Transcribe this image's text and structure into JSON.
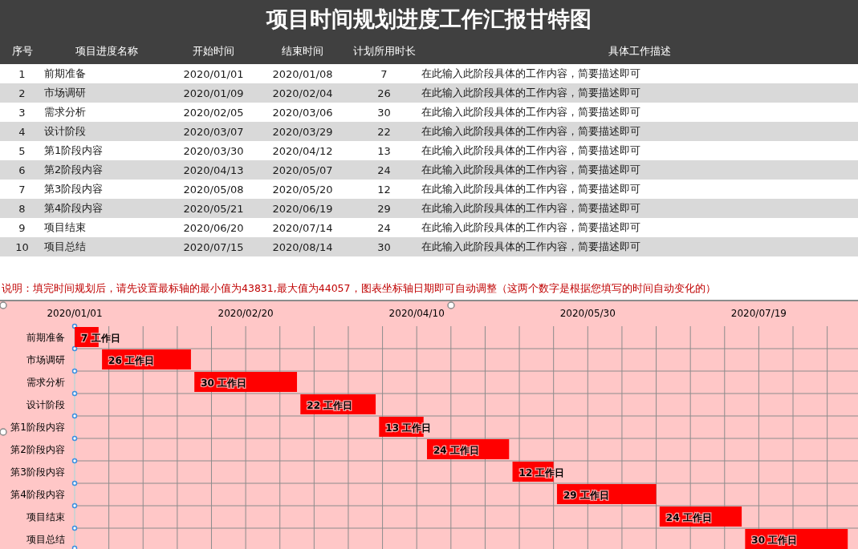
{
  "title": "项目时间规划进度工作汇报甘特图",
  "table": {
    "columns": [
      "序号",
      "项目进度名称",
      "开始时间",
      "结束时间",
      "计划所用时长",
      "具体工作描述"
    ],
    "rows": [
      [
        "1",
        "前期准备",
        "2020/01/01",
        "2020/01/08",
        "7",
        "在此输入此阶段具体的工作内容，简要描述即可"
      ],
      [
        "2",
        "市场调研",
        "2020/01/09",
        "2020/02/04",
        "26",
        "在此输入此阶段具体的工作内容，简要描述即可"
      ],
      [
        "3",
        "需求分析",
        "2020/02/05",
        "2020/03/06",
        "30",
        "在此输入此阶段具体的工作内容，简要描述即可"
      ],
      [
        "4",
        "设计阶段",
        "2020/03/07",
        "2020/03/29",
        "22",
        "在此输入此阶段具体的工作内容，简要描述即可"
      ],
      [
        "5",
        "第1阶段内容",
        "2020/03/30",
        "2020/04/12",
        "13",
        "在此输入此阶段具体的工作内容，简要描述即可"
      ],
      [
        "6",
        "第2阶段内容",
        "2020/04/13",
        "2020/05/07",
        "24",
        "在此输入此阶段具体的工作内容，简要描述即可"
      ],
      [
        "7",
        "第3阶段内容",
        "2020/05/08",
        "2020/05/20",
        "12",
        "在此输入此阶段具体的工作内容，简要描述即可"
      ],
      [
        "8",
        "第4阶段内容",
        "2020/05/21",
        "2020/06/19",
        "29",
        "在此输入此阶段具体的工作内容，简要描述即可"
      ],
      [
        "9",
        "项目结束",
        "2020/06/20",
        "2020/07/14",
        "24",
        "在此输入此阶段具体的工作内容，简要描述即可"
      ],
      [
        "10",
        "项目总结",
        "2020/07/15",
        "2020/08/14",
        "30",
        "在此输入此阶段具体的工作内容，简要描述即可"
      ]
    ]
  },
  "note": "说明：填完时间规划后，请先设置最标轴的最小值为43831,最大值为44057，图表坐标轴日期即可自动调整（这两个数字是根据您填写的时间自动变化的）",
  "gantt": {
    "axis_labels": [
      "2020/01/01",
      "2020/02/20",
      "2020/04/10",
      "2020/05/30",
      "2020/07/19"
    ],
    "tasks": [
      {
        "name": "前期准备",
        "bar_label": "7 工作日"
      },
      {
        "name": "市场调研",
        "bar_label": "26 工作日"
      },
      {
        "name": "需求分析",
        "bar_label": "30 工作日"
      },
      {
        "name": "设计阶段",
        "bar_label": "22 工作日"
      },
      {
        "name": "第1阶段内容",
        "bar_label": "13 工作日"
      },
      {
        "name": "第2阶段内容",
        "bar_label": "24 工作日"
      },
      {
        "name": "第3阶段内容",
        "bar_label": "12 工作日"
      },
      {
        "name": "第4阶段内容",
        "bar_label": "29 工作日"
      },
      {
        "name": "项目结束",
        "bar_label": "24 工作日"
      },
      {
        "name": "项目总结",
        "bar_label": "30 工作日"
      }
    ]
  }
}
